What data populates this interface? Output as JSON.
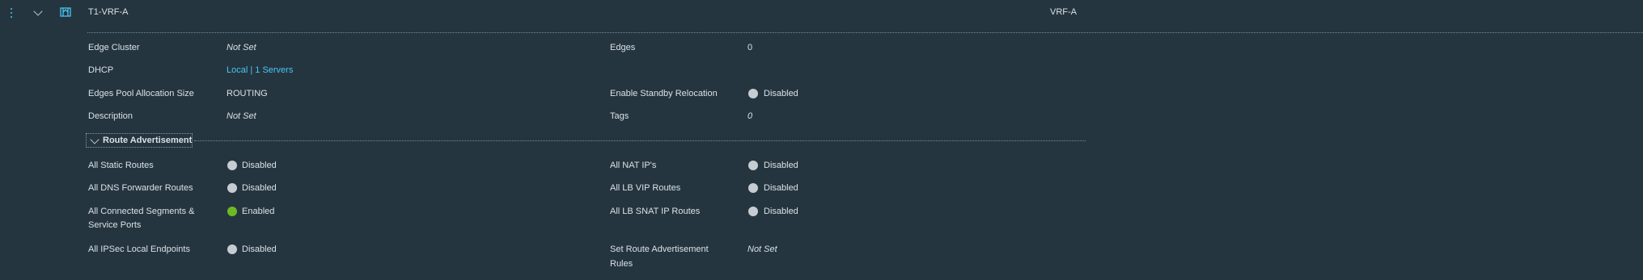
{
  "header": {
    "name": "T1-VRF-A",
    "vrf": "VRF-A"
  },
  "details": {
    "edge_cluster": {
      "label": "Edge Cluster",
      "value": "Not Set"
    },
    "edges": {
      "label": "Edges",
      "value": "0"
    },
    "dhcp": {
      "label": "DHCP",
      "value": "Local | 1 Servers"
    },
    "edges_pool": {
      "label": "Edges Pool Allocation Size",
      "value": "ROUTING"
    },
    "standby_relocation": {
      "label": "Enable Standby Relocation",
      "value": "Disabled"
    },
    "description": {
      "label": "Description",
      "value": "Not Set"
    },
    "tags": {
      "label": "Tags",
      "value": "0"
    }
  },
  "route_advertisement": {
    "title": "Route Advertisement",
    "static_routes": {
      "label": "All Static Routes",
      "value": "Disabled"
    },
    "nat_ips": {
      "label": "All NAT IP's",
      "value": "Disabled"
    },
    "dns_forwarder": {
      "label": "All DNS Forwarder Routes",
      "value": "Disabled"
    },
    "lb_vip": {
      "label": "All LB VIP Routes",
      "value": "Disabled"
    },
    "connected_segments": {
      "label_line1": "All Connected Segments &",
      "label_line2": "Service Ports",
      "value": "Enabled"
    },
    "lb_snat": {
      "label": "All LB SNAT IP Routes",
      "value": "Disabled"
    },
    "ipsec": {
      "label": "All IPSec Local Endpoints",
      "value": "Disabled"
    },
    "rules": {
      "label_line1": "Set Route Advertisement",
      "label_line2": "Rules",
      "value": "Not Set"
    }
  },
  "colors": {
    "background": "#25353f",
    "link": "#49c5f2",
    "enabled": "#6eb825",
    "disabled": "#c5cdd3"
  }
}
